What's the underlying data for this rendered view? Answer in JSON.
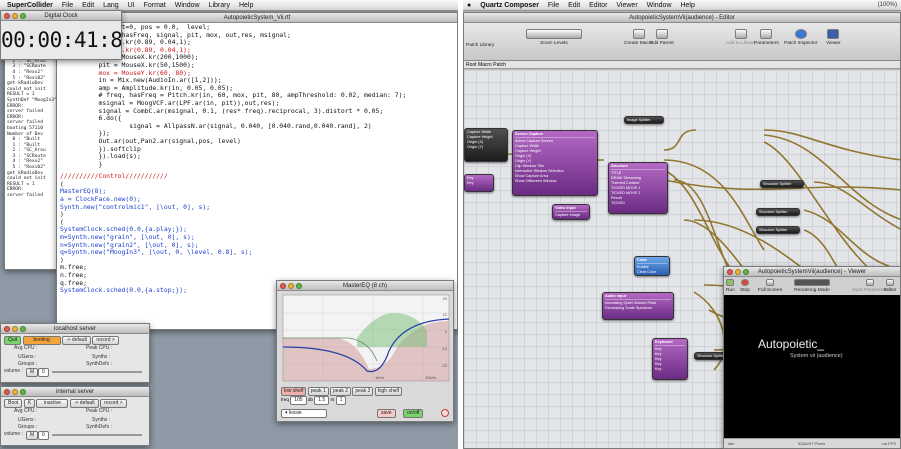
{
  "left": {
    "menubar": {
      "app": "SuperCollider",
      "items": [
        "File",
        "Edit",
        "Lang",
        "UI",
        "Format",
        "Window",
        "Library",
        "Help"
      ]
    },
    "clock": {
      "title": "Digital Clock",
      "time": "00:00:41:8"
    },
    "editor": {
      "title": "AutopoieticSystem_Vii.rtf",
      "code_top": [
        "          arg out=0, pos = 0.0,  level;",
        "          freq, hasFreq, signal, pit, mox, out,res, msignal;",
        "          MouseX.kr(0.89, 0.04,1);",
        "          MouseY.kr(0.89, 0.04,1);",
        "          out = MouseX.kr(200,1000);",
        "          pit = MouseX.kr(50,1500);",
        "          mox = MouseY.kr(60, 80);",
        "          in = Mix.new(AudioIn.ar([1,2]));",
        "          amp = Amplitude.kr(in, 0.05, 0.05);",
        "          # freq, hasFreq = Pitch.kr(in, 60, mox, pit, 80, ampThreshold: 0.02, median: 7);",
        "          msignal = MoogVCF.ar(LPF.ar(in, pit)),out,res);",
        "          signal = CombC.ar(msignal, 0.1, (res* freq).reciprocal, 3).distort * 0.05;",
        "          6.do({",
        "                  signal = AllpassN.ar(signal, 0.040, [0.040.rand,0.040.rand], 2)",
        "          });",
        "          Out.ar(out,Pan2.ar(signal,pos, level)",
        "          }).softclip",
        "          }).load(s);",
        "          }"
      ],
      "code_bottom": [
        "//////////Control///////////",
        "(",
        "MasterEQ(8);",
        "a = ClockFace.new(0);",
        "Synth.new(\"controlmic1\", [\\out, 0], s);",
        ")",
        "(",
        "SystemClock.sched(0.0,{a.play;});",
        "m=Synth.new(\"grain\", [\\out, 0], s);",
        "n=Synth.new(\"grain2\", [\\out, 0], s);",
        "q=Synth.new(\"MoogIn3\", [\\out, 0, \\level, 0.8], s);",
        ")",
        "m.free;",
        "n.free;",
        "q.free;",
        "SystemClock.sched(0.0,{a.stop;});"
      ]
    },
    "postwindow": {
      "lines": [
        "Num",
        "  0 : \"Built",
        "  1 : \"Built",
        "  2 : \"SC_Arou",
        "  3 : \"SCRoute",
        "  4 : \"Rexx2\"",
        "  5 : \"Roxi02\"",
        "",
        "get kRadioDev",
        "could not init",
        "RESULT = 1",
        "",
        "SynthDef \"MoogIn3\"",
        "ERROR:",
        "server failed",
        "ERROR:",
        "server failed",
        "booting 57110",
        "Number of Dev",
        "  0 : \"Built",
        "  1 : \"Built",
        "  2 : \"SC_Arou",
        "  3 : \"SCRoute",
        "  4 : \"Rexx2\"",
        "  5 : \"Roxi02\"",
        "",
        "get kRadioDev",
        "could not init",
        "RESULT = 1",
        "ERROR:",
        "server failed"
      ]
    },
    "localhost": {
      "title": "localhost server",
      "quit": "Quit",
      "status": "booting",
      "default": "-> default",
      "record": "record >",
      "avg_cpu": "Avg CPU :",
      "peak_cpu": "Peak CPU :",
      "ugens": "UGens :",
      "synths": "Synths :",
      "groups": "Groups :",
      "synthdefs": "SynthDefs :",
      "volume": "volume :",
      "mute": "M",
      "vol_val": "0"
    },
    "internal": {
      "title": "internal server",
      "boot": "Boot",
      "k": "K",
      "status": "inactive",
      "default": "-> default",
      "record": "record >",
      "avg_cpu": "Avg CPU :",
      "peak_cpu": "Peak CPU :",
      "ugens": "UGens :",
      "synths": "Synths :",
      "groups": "Groups :",
      "synthdefs": "SynthDefs :",
      "volume": "volume :",
      "mute": "M",
      "vol_val": "0"
    },
    "eq": {
      "title": "MasterEQ (8 ch)",
      "bands": [
        "low shelf",
        "peak 1",
        "peak 2",
        "peak 3",
        "high shelf"
      ],
      "freq_lbl": "freq",
      "freq_val": "105",
      "db_lbl": "db",
      "db_val": "1.5",
      "rs_lbl": "rs",
      "rs_val": "1",
      "preset": "lessie",
      "save": "save",
      "enabled": "on/off",
      "db_ticks": [
        "20",
        "10",
        "0",
        "-10",
        "-20"
      ],
      "hz_ticks": [
        "1kHz",
        "10kHz"
      ]
    }
  },
  "right": {
    "menubar": {
      "app": "Quartz Composer",
      "items": [
        "File",
        "Edit",
        "Editor",
        "Viewer",
        "Window",
        "Help"
      ],
      "status": "(100%)"
    },
    "editor": {
      "title": "AutopoieticSystemVii(audience) - Editor",
      "tools": [
        "Patch Library",
        "Zoom Levels",
        "Create Macro",
        "Edit Parent",
        "Add to Library",
        "Parameters",
        "Patch Inspector",
        "Viewer"
      ],
      "breadcrumb": "Root Macro Patch"
    },
    "patches": [
      {
        "title": "",
        "lines": [
          "Capture Width",
          "Capture Height",
          "Origin (X)",
          "Origin (Y)"
        ]
      },
      {
        "title": "",
        "lines": [
          "Key",
          "Key"
        ]
      },
      {
        "title": "Screen Capture",
        "lines": [
          "Active Capture Screen",
          "Capture Width",
          "Capture Height",
          "Origin (X)",
          "Origin (Y)",
          "Clip Window Title",
          "Interactive Window Selection",
          "Show Capture Area",
          "Show Offscreen Window"
        ]
      },
      {
        "title": "Video Input",
        "lines": [
          "Capture Image"
        ]
      },
      {
        "title": "Image Splitter",
        "lines": []
      },
      {
        "title": "Image Splitter",
        "lines": []
      },
      {
        "title": "Structure",
        "lines": [
          "TITLE",
          "DRAW Streaming",
          "Themed Content",
          "TICKED MOVE 1",
          "TICKED MOVE 2",
          "Result",
          "TICKED"
        ]
      },
      {
        "title": "Color",
        "lines": [
          "Enable",
          "Clear Color"
        ]
      },
      {
        "title": "Audio Input",
        "lines": [
          "Increasing Quiet",
          "Decreasing Scale",
          "Volume Peak",
          "Spectrum"
        ]
      },
      {
        "title": "Keyboard",
        "lines": [
          "Key",
          "Key",
          "Key",
          "Key",
          "Key"
        ]
      },
      {
        "title": "Structure Splitter",
        "lines": []
      },
      {
        "title": "Structure Splitter",
        "lines": []
      },
      {
        "title": "Structure Splitter",
        "lines": []
      },
      {
        "title": "Structure Splitter",
        "lines": []
      }
    ],
    "viewer": {
      "title": "AutopoieticSystemVii(audience) - Viewer",
      "run": "Run",
      "stop": "Stop",
      "fullscreen": "Full Screen",
      "rendering_mode": "Rendering Mode",
      "input_params": "Input Parameters",
      "editor": "Editor",
      "screen_title": "Autopoietic_",
      "screen_sub": "System vii (audience)",
      "footer_left": "Idle",
      "footer_mid": "528x297 Pixels",
      "footer_right": "n/a FPS"
    }
  }
}
